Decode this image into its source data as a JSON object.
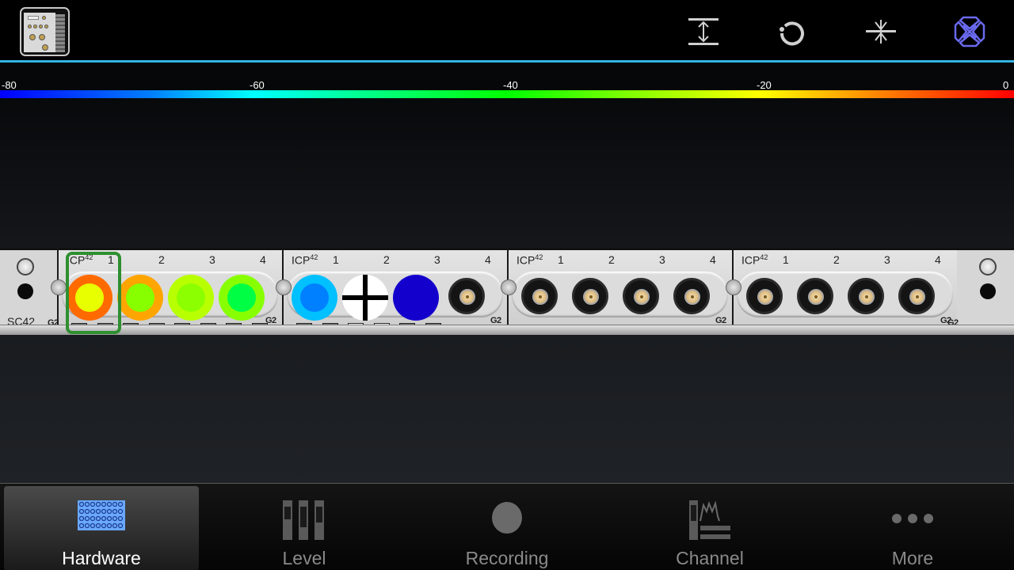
{
  "toolbar": {
    "device_thumbnail": "SC42 device",
    "buttons": [
      {
        "name": "fit-height-button",
        "icon": "fit-vertical-icon"
      },
      {
        "name": "reset-button",
        "icon": "refresh-icon"
      },
      {
        "name": "collapse-button",
        "icon": "compress-icon"
      },
      {
        "name": "cluster-button",
        "icon": "x-cluster-icon",
        "active": true
      }
    ],
    "accent_color": "#33b5e5"
  },
  "colorbar": {
    "ticks": [
      "-80",
      "-60",
      "-40",
      "-20",
      "0"
    ],
    "min": -80,
    "max": 0
  },
  "rack": {
    "left_cap": {
      "label": "SC42",
      "g2": "G2"
    },
    "right_cap": {
      "g2": "G2"
    },
    "modules": [
      {
        "name_main": "ICP",
        "name_sup": "42",
        "g2": "G2",
        "channels": [
          {
            "num": "1",
            "type": "led",
            "outer": "#ff6a00",
            "inner": "#e8ff00",
            "selected": true
          },
          {
            "num": "2",
            "type": "led",
            "outer": "#ffa500",
            "inner": "#88ff00"
          },
          {
            "num": "3",
            "type": "led",
            "outer": "#b8ff00",
            "inner": "#8cff00"
          },
          {
            "num": "4",
            "type": "led",
            "outer": "#88ff00",
            "inner": "#00ff44"
          }
        ],
        "pads": [
          false,
          false,
          false,
          false,
          false,
          false,
          false,
          false
        ]
      },
      {
        "name_main": "ICP",
        "name_sup": "42",
        "g2": "G2",
        "channels": [
          {
            "num": "1",
            "type": "led",
            "outer": "#00c0ff",
            "inner": "#0080ff"
          },
          {
            "num": "2",
            "type": "cross"
          },
          {
            "num": "3",
            "type": "led",
            "outer": "#1400cc",
            "inner": "#1400cc"
          },
          {
            "num": "4",
            "type": "connector"
          }
        ],
        "pads": [
          false,
          false,
          true,
          true,
          false,
          false
        ]
      },
      {
        "name_main": "ICP",
        "name_sup": "42",
        "g2": "G2",
        "channels": [
          {
            "num": "1",
            "type": "connector"
          },
          {
            "num": "2",
            "type": "connector"
          },
          {
            "num": "3",
            "type": "connector"
          },
          {
            "num": "4",
            "type": "connector"
          }
        ],
        "pads": []
      },
      {
        "name_main": "ICP",
        "name_sup": "42",
        "g2": "G2",
        "channels": [
          {
            "num": "1",
            "type": "connector"
          },
          {
            "num": "2",
            "type": "connector"
          },
          {
            "num": "3",
            "type": "connector"
          },
          {
            "num": "4",
            "type": "connector"
          }
        ],
        "pads": []
      }
    ]
  },
  "bottom_nav": {
    "items": [
      {
        "label": "Hardware",
        "icon": "hardware-grid-icon",
        "active": true
      },
      {
        "label": "Level",
        "icon": "level-bars-icon"
      },
      {
        "label": "Recording",
        "icon": "record-circle-icon"
      },
      {
        "label": "Channel",
        "icon": "channel-spectrum-icon"
      },
      {
        "label": "More",
        "icon": "more-dots-icon"
      }
    ]
  }
}
